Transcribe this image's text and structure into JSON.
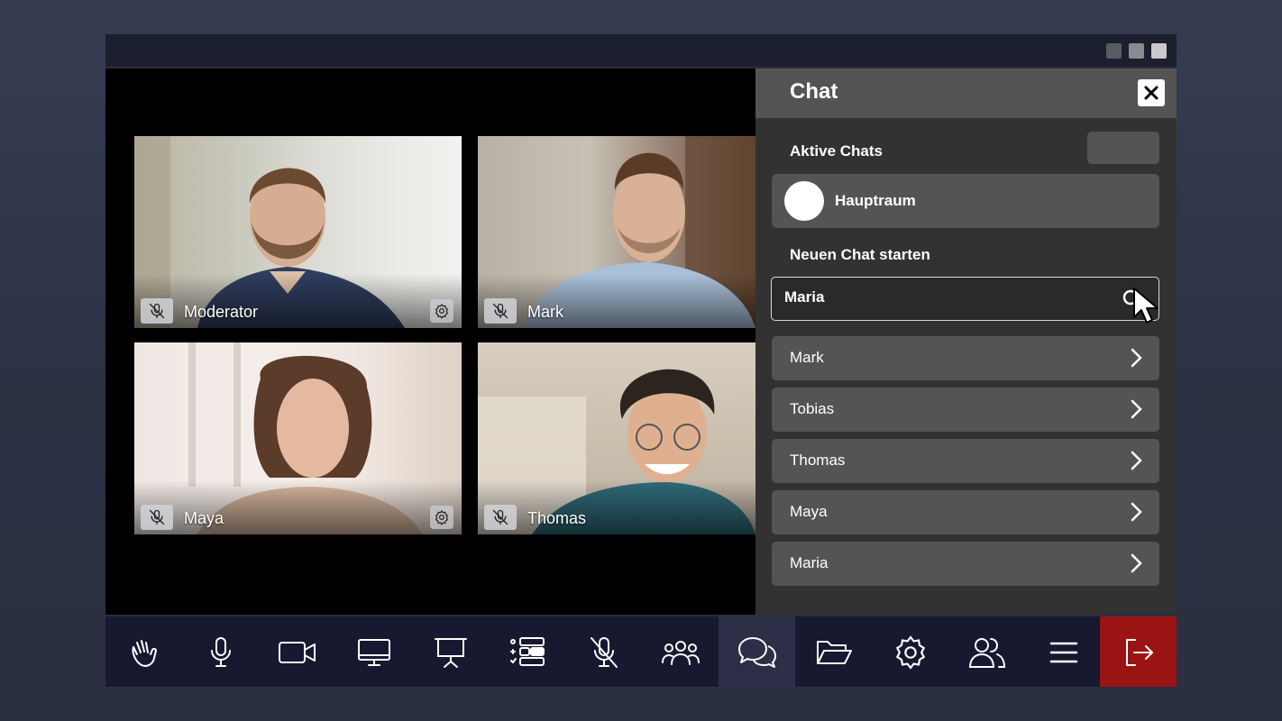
{
  "participants": [
    {
      "name": "Moderator",
      "has_settings": true
    },
    {
      "name": "Mark",
      "has_settings": false
    },
    {
      "name": "Maya",
      "has_settings": true
    },
    {
      "name": "Thomas",
      "has_settings": false
    }
  ],
  "chat": {
    "title": "Chat",
    "active_section_label": "Aktive Chats",
    "active_chats": [
      "Hauptraum"
    ],
    "new_chat_label": "Neuen Chat starten",
    "search_value": "Maria",
    "contacts": [
      "Mark",
      "Tobias",
      "Thomas",
      "Maya",
      "Maria"
    ]
  },
  "toolbar": {
    "icons": [
      "raise-hand-icon",
      "microphone-icon",
      "video-camera-icon",
      "screen-share-icon",
      "presentation-icon",
      "polls-icon",
      "mute-all-icon",
      "participants-icon",
      "chat-icon",
      "folder-icon",
      "settings-icon",
      "user-management-icon",
      "menu-icon",
      "leave-icon"
    ],
    "active": "chat-icon"
  },
  "colors": {
    "leave_button": "#9b1414",
    "panel_header": "#545454",
    "panel_bg": "#323232",
    "toolbar_bg": "#161930"
  }
}
